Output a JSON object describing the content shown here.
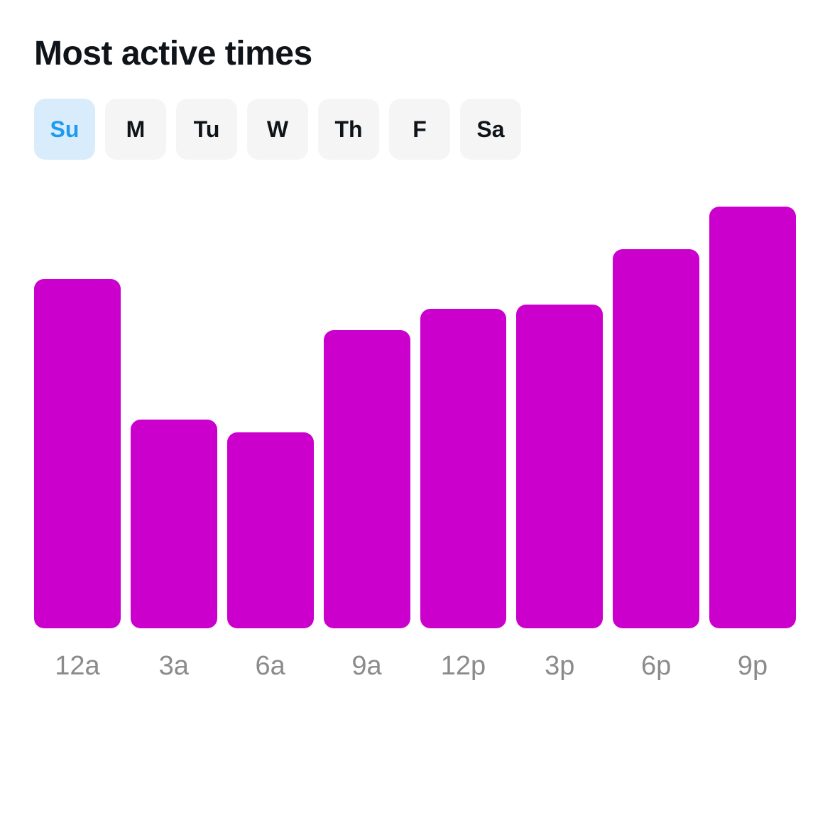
{
  "title": "Most active times",
  "days": [
    {
      "label": "Su",
      "active": true
    },
    {
      "label": "M",
      "active": false
    },
    {
      "label": "Tu",
      "active": false
    },
    {
      "label": "W",
      "active": false
    },
    {
      "label": "Th",
      "active": false
    },
    {
      "label": "F",
      "active": false
    },
    {
      "label": "Sa",
      "active": false
    }
  ],
  "chart_data": {
    "type": "bar",
    "categories": [
      "12a",
      "3a",
      "6a",
      "9a",
      "12p",
      "3p",
      "6p",
      "9p"
    ],
    "values": [
      82,
      49,
      46,
      70,
      75,
      76,
      89,
      99
    ],
    "title": "Most active times",
    "xlabel": "",
    "ylabel": "",
    "ylim": [
      0,
      100
    ],
    "color": "#cc00cc"
  }
}
